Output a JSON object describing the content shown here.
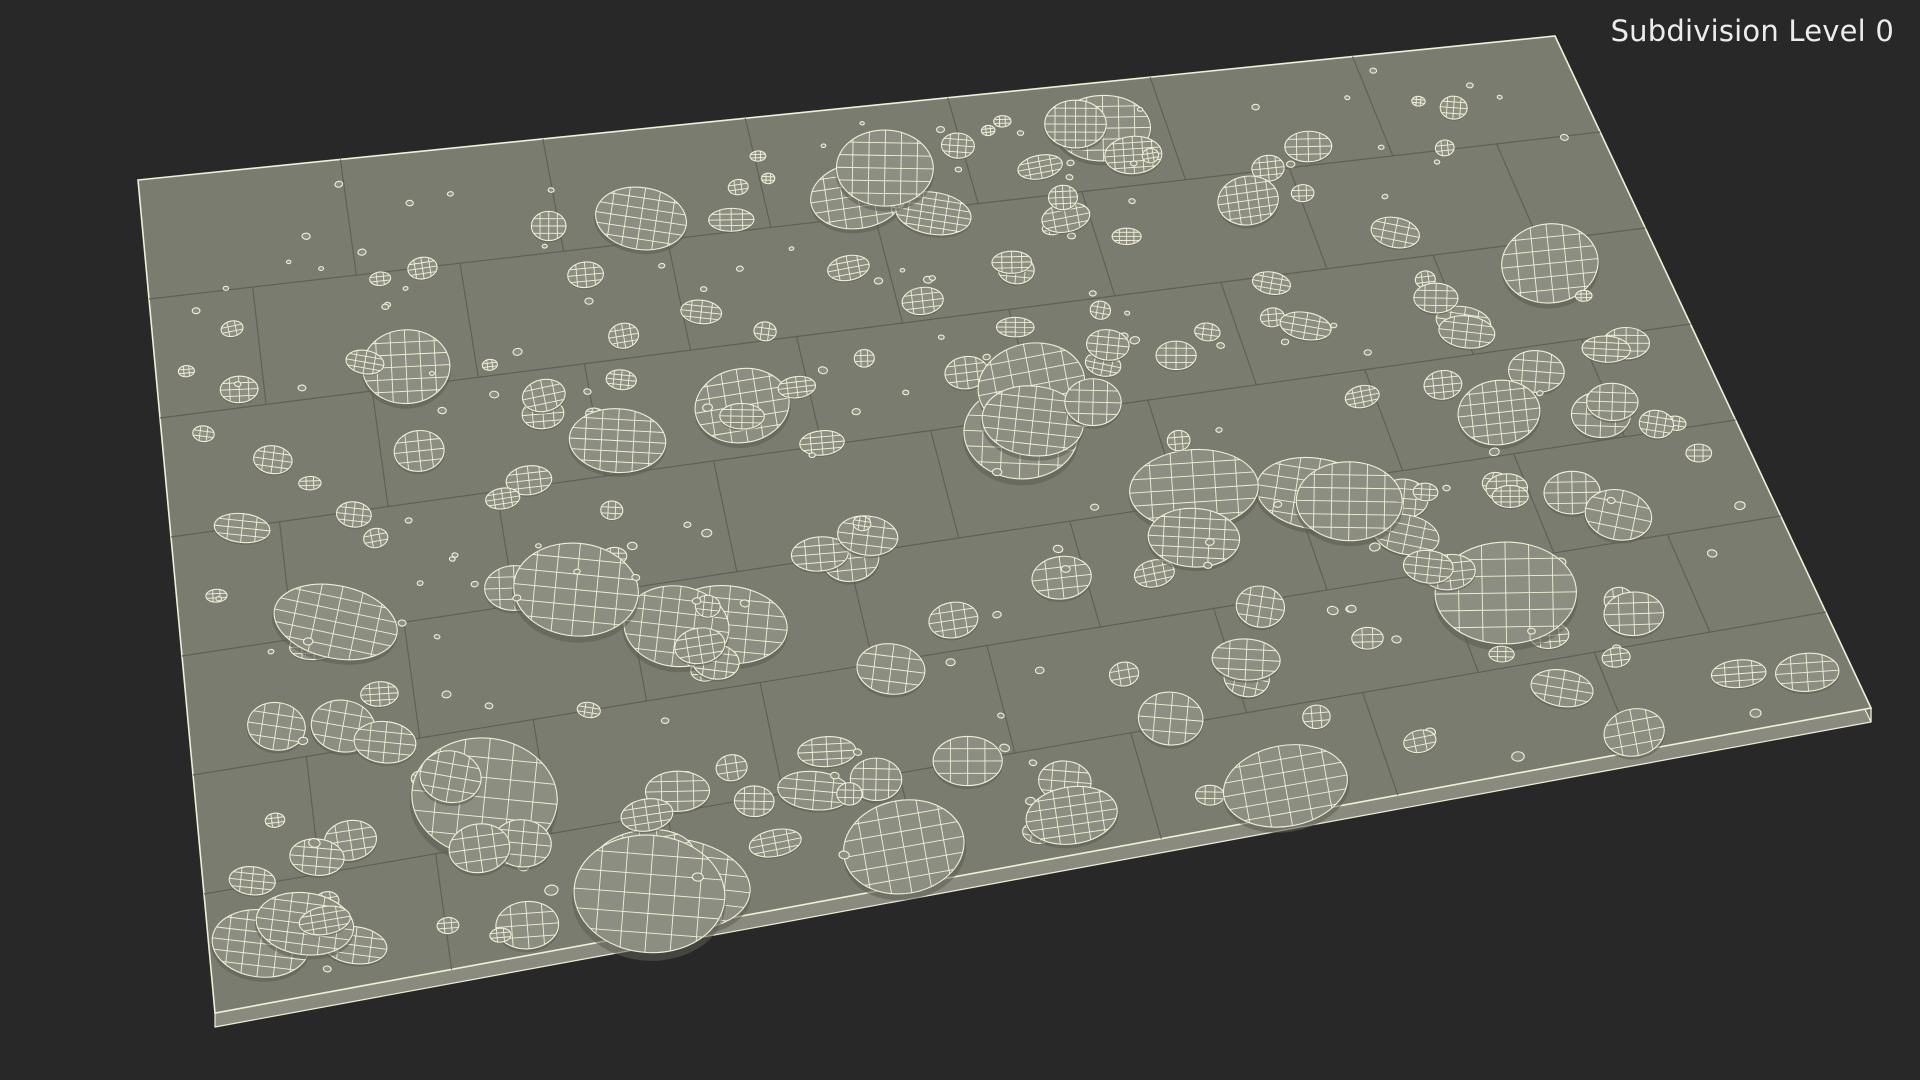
{
  "viewport": {
    "label": "Subdivision Level 0",
    "background_color": "#282828",
    "label_color": "#ececec"
  },
  "model": {
    "surface_color": "#7b7c70",
    "wire_color": "#f0efd8",
    "tile_grid": [
      7,
      7
    ]
  }
}
